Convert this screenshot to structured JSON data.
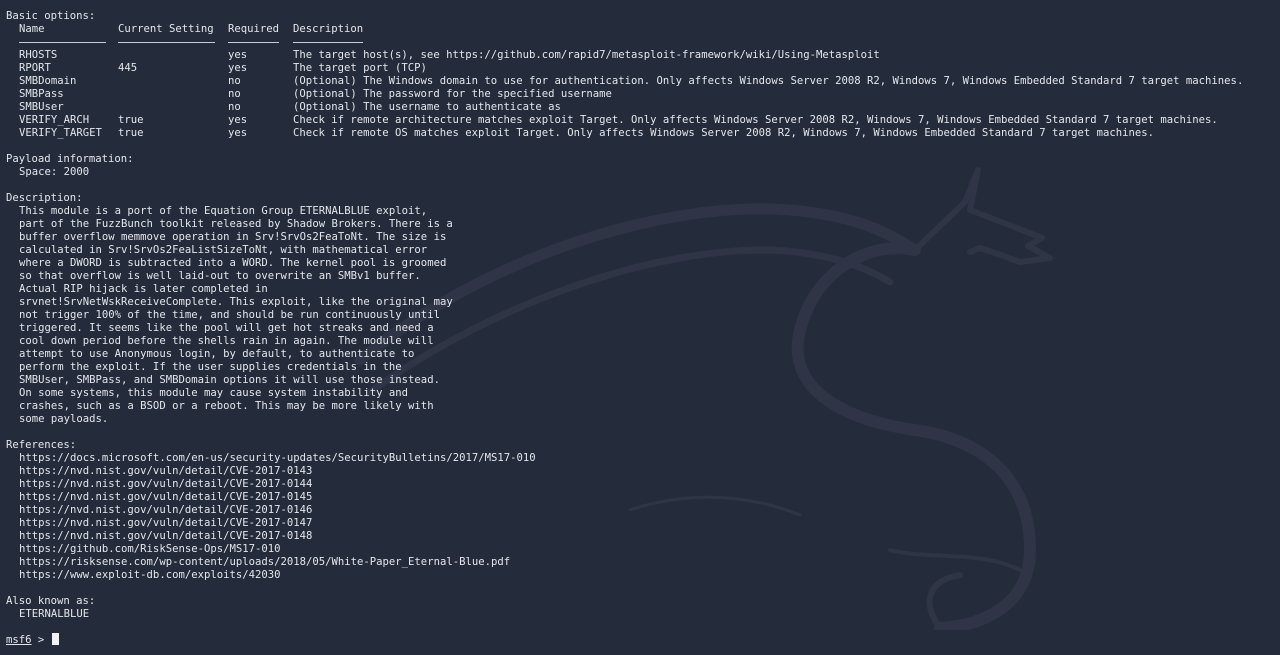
{
  "basic_options": {
    "heading": "Basic options:",
    "columns": [
      "Name",
      "Current Setting",
      "Required",
      "Description"
    ],
    "rows": [
      {
        "name": "RHOSTS",
        "setting": "",
        "required": "yes",
        "description": "The target host(s), see https://github.com/rapid7/metasploit-framework/wiki/Using-Metasploit"
      },
      {
        "name": "RPORT",
        "setting": "445",
        "required": "yes",
        "description": "The target port (TCP)"
      },
      {
        "name": "SMBDomain",
        "setting": "",
        "required": "no",
        "description": "(Optional) The Windows domain to use for authentication. Only affects Windows Server 2008 R2, Windows 7, Windows Embedded Standard 7 target machines."
      },
      {
        "name": "SMBPass",
        "setting": "",
        "required": "no",
        "description": "(Optional) The password for the specified username"
      },
      {
        "name": "SMBUser",
        "setting": "",
        "required": "no",
        "description": "(Optional) The username to authenticate as"
      },
      {
        "name": "VERIFY_ARCH",
        "setting": "true",
        "required": "yes",
        "description": "Check if remote architecture matches exploit Target. Only affects Windows Server 2008 R2, Windows 7, Windows Embedded Standard 7 target machines."
      },
      {
        "name": "VERIFY_TARGET",
        "setting": "true",
        "required": "yes",
        "description": "Check if remote OS matches exploit Target. Only affects Windows Server 2008 R2, Windows 7, Windows Embedded Standard 7 target machines."
      }
    ]
  },
  "payload": {
    "heading": "Payload information:",
    "space": "Space: 2000"
  },
  "description": {
    "heading": "Description:",
    "lines": [
      "This module is a port of the Equation Group ETERNALBLUE exploit,",
      "part of the FuzzBunch toolkit released by Shadow Brokers. There is a",
      "buffer overflow memmove operation in Srv!SrvOs2FeaToNt. The size is",
      "calculated in Srv!SrvOs2FeaListSizeToNt, with mathematical error",
      "where a DWORD is subtracted into a WORD. The kernel pool is groomed",
      "so that overflow is well laid-out to overwrite an SMBv1 buffer.",
      "Actual RIP hijack is later completed in",
      "srvnet!SrvNetWskReceiveComplete. This exploit, like the original may",
      "not trigger 100% of the time, and should be run continuously until",
      "triggered. It seems like the pool will get hot streaks and need a",
      "cool down period before the shells rain in again. The module will",
      "attempt to use Anonymous login, by default, to authenticate to",
      "perform the exploit. If the user supplies credentials in the",
      "SMBUser, SMBPass, and SMBDomain options it will use those instead.",
      "On some systems, this module may cause system instability and",
      "crashes, such as a BSOD or a reboot. This may be more likely with",
      "some payloads."
    ]
  },
  "references": {
    "heading": "References:",
    "items": [
      "https://docs.microsoft.com/en-us/security-updates/SecurityBulletins/2017/MS17-010",
      "https://nvd.nist.gov/vuln/detail/CVE-2017-0143",
      "https://nvd.nist.gov/vuln/detail/CVE-2017-0144",
      "https://nvd.nist.gov/vuln/detail/CVE-2017-0145",
      "https://nvd.nist.gov/vuln/detail/CVE-2017-0146",
      "https://nvd.nist.gov/vuln/detail/CVE-2017-0147",
      "https://nvd.nist.gov/vuln/detail/CVE-2017-0148",
      "https://github.com/RiskSense-Ops/MS17-010",
      "https://risksense.com/wp-content/uploads/2018/05/White-Paper_Eternal-Blue.pdf",
      "https://www.exploit-db.com/exploits/42030"
    ]
  },
  "also_known_as": {
    "heading": "Also known as:",
    "items": [
      "ETERNALBLUE"
    ]
  },
  "prompt": {
    "name": "msf6",
    "symbol": " >"
  },
  "colors": {
    "background": "#242b3b",
    "foreground": "#e4e6ea",
    "watermark": "#323848"
  },
  "icons": {
    "watermark": "kali-dragon-icon"
  }
}
